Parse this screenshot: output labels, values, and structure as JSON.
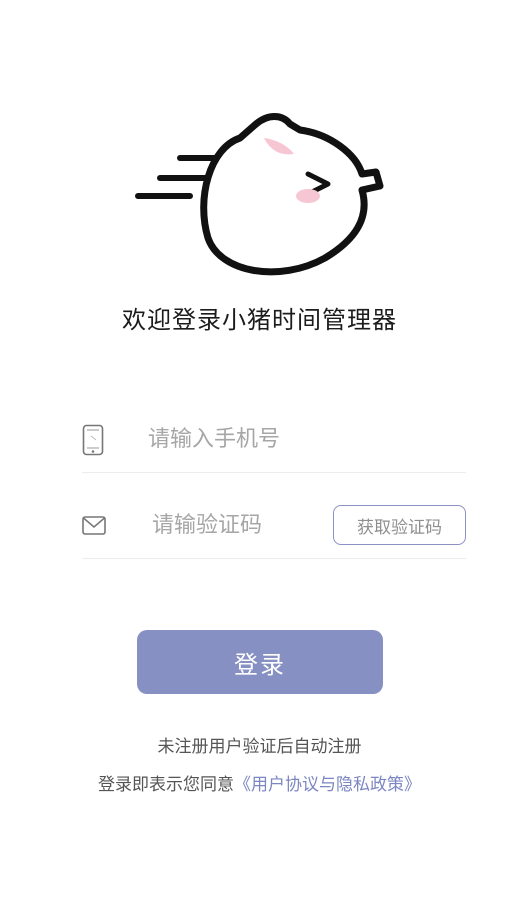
{
  "app": {
    "welcome_title": "欢迎登录小猪时间管理器"
  },
  "colors": {
    "accent": "#8790c2",
    "link": "#7b86c2",
    "placeholder": "#a6a6a6",
    "pig_blush": "#f7c6d3",
    "pig_outline": "#111111"
  },
  "form": {
    "phone": {
      "icon": "phone-icon",
      "placeholder": "请输入手机号",
      "value": ""
    },
    "code": {
      "icon": "mail-icon",
      "placeholder": "请输验证码",
      "value": ""
    },
    "get_code_label": "获取验证码",
    "login_label": "登录"
  },
  "footer": {
    "auto_register_note": "未注册用户验证后自动注册",
    "agree_prefix": "登录即表示您同意",
    "agreement_link": "《用户协议与隐私政策》"
  }
}
